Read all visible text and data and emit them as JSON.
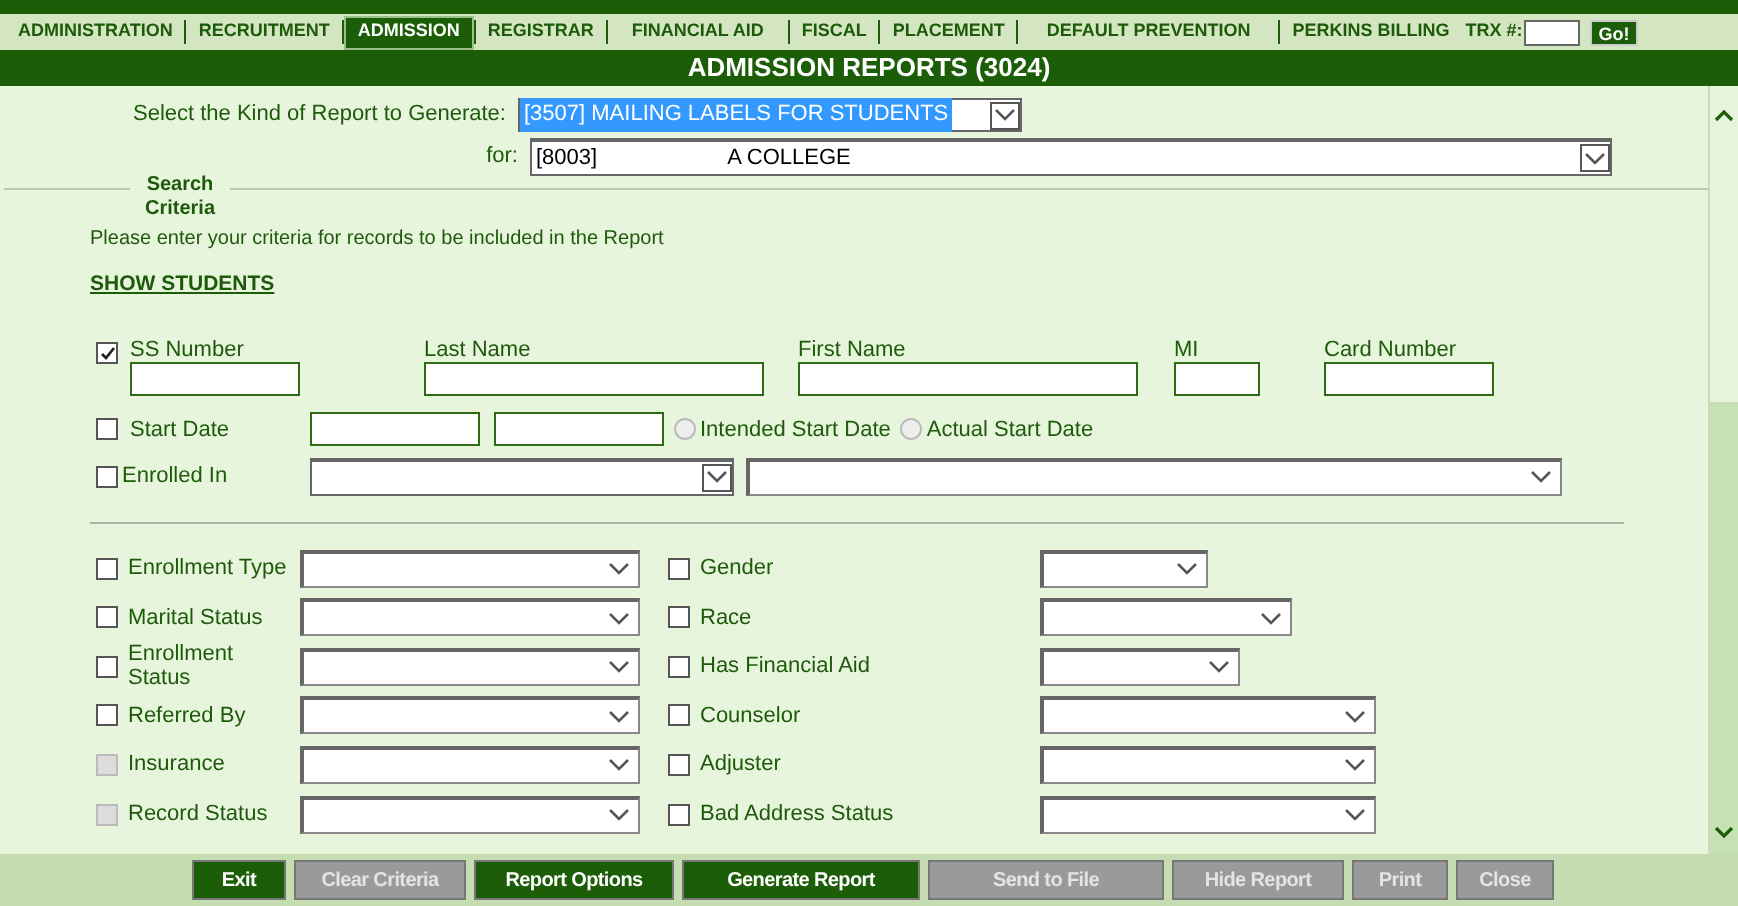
{
  "tabs": [
    {
      "label": "ADMINISTRATION",
      "selected": false
    },
    {
      "label": "RECRUITMENT",
      "selected": false
    },
    {
      "label": "ADMISSION",
      "selected": true
    },
    {
      "label": "REGISTRAR",
      "selected": false
    },
    {
      "label": "FINANCIAL AID",
      "selected": false
    },
    {
      "label": "FISCAL",
      "selected": false
    },
    {
      "label": "PLACEMENT",
      "selected": false
    },
    {
      "label": "DEFAULT PREVENTION",
      "selected": false
    },
    {
      "label": "PERKINS BILLING",
      "selected": false
    }
  ],
  "trx": {
    "label": "TRX #:",
    "button": "Go!"
  },
  "title": "ADMISSION REPORTS (3024)",
  "report_kind": {
    "label": "Select the Kind of Report to Generate:",
    "value": "[3507] MAILING LABELS FOR STUDENTS",
    "selected": true
  },
  "report_for": {
    "label": "for:",
    "value_start": "[8003]",
    "value_end": "A COLLEGE"
  },
  "search": {
    "legend": "Search Criteria",
    "instructions": "Please enter your criteria for records to be included in the Report",
    "link": "SHOW STUDENTS"
  },
  "id_fields": [
    {
      "label": "SS Number",
      "checked": true
    },
    {
      "label": "Last Name"
    },
    {
      "label": "First Name"
    },
    {
      "label": "MI"
    },
    {
      "label": "Card Number"
    }
  ],
  "start_date": {
    "label": "Start Date",
    "checked": false,
    "options": [
      {
        "label": "Intended Start Date",
        "selected": false
      },
      {
        "label": "Actual Start Date",
        "selected": false
      }
    ]
  },
  "enrolled_in": {
    "label": "Enrolled In",
    "checked": false
  },
  "criteria": [
    {
      "left": {
        "label": "Enrollment Type",
        "checked": false,
        "disabled": false
      },
      "right": {
        "label": "Gender",
        "checked": false,
        "disabled": false
      }
    },
    {
      "left": {
        "label": "Marital Status",
        "checked": false,
        "disabled": false
      },
      "right": {
        "label": "Race",
        "checked": false,
        "disabled": false
      }
    },
    {
      "left": {
        "label": "Enrollment Status",
        "checked": false,
        "disabled": false
      },
      "right": {
        "label": "Has Financial Aid",
        "checked": false,
        "disabled": false
      }
    },
    {
      "left": {
        "label": "Referred By",
        "checked": false,
        "disabled": false
      },
      "right": {
        "label": "Counselor",
        "checked": false,
        "disabled": false
      }
    },
    {
      "left": {
        "label": "Insurance",
        "checked": false,
        "disabled": true
      },
      "right": {
        "label": "Adjuster",
        "checked": false,
        "disabled": false
      }
    },
    {
      "left": {
        "label": "Record Status",
        "checked": false,
        "disabled": true
      },
      "right": {
        "label": "Bad Address Status",
        "checked": false,
        "disabled": false
      }
    }
  ],
  "buttons": [
    {
      "label": "Exit",
      "disabled": false
    },
    {
      "label": "Clear Criteria",
      "disabled": true
    },
    {
      "label": "Report Options",
      "disabled": false
    },
    {
      "label": "Generate Report",
      "disabled": false
    },
    {
      "label": "Send to File",
      "disabled": true
    },
    {
      "label": "Hide Report",
      "disabled": true
    },
    {
      "label": "Print",
      "disabled": true
    },
    {
      "label": "Close",
      "disabled": true
    }
  ]
}
